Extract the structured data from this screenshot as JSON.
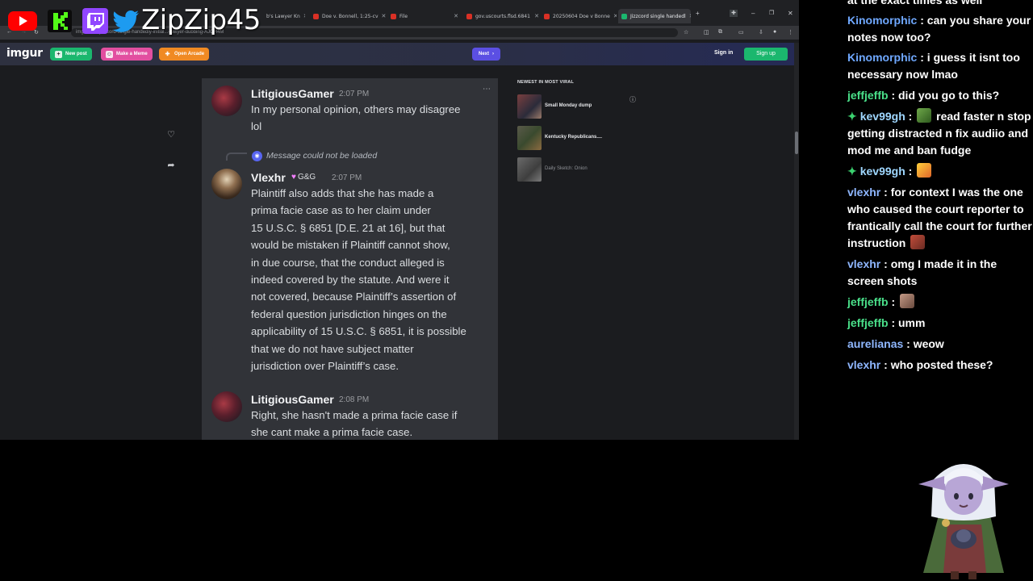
{
  "browser": {
    "tabs": [
      {
        "label": "b's Lawyer Kn",
        "color": "#8ab4f8"
      },
      {
        "label": "Doe v. Bonnell, 1:25-cv",
        "color": "#d93025"
      },
      {
        "label": "File",
        "color": "#d93025"
      },
      {
        "label": "gov.uscourts.flsd.6841",
        "color": "#d93025"
      },
      {
        "label": "20250604 Doe v Bonne",
        "color": "#d93025"
      },
      {
        "label": "Jizzcord single handedl",
        "color": "#1bb76e"
      }
    ],
    "url": "imgur.com/jizzcord-single-handedly-initial...-lawyer-dubbing-AJOH4M"
  },
  "imgur": {
    "logo": "imgur",
    "new_post": "New post",
    "make_meme": "Make a Meme",
    "open_arcade": "Open Arcade",
    "next": "Next",
    "sign_in": "Sign in",
    "sign_up": "Sign up"
  },
  "discord": {
    "messages": [
      {
        "user": "LitigiousGamer",
        "time": "2:07 PM",
        "lines": [
          "In my personal opinion, others may disagree",
          "lol"
        ]
      },
      {
        "reply_text": "Message could not be loaded",
        "user": "Vlexhr",
        "role": "G&G",
        "time": "2:07 PM",
        "lines": [
          "Plaintiff also adds that she has made a",
          "prima facie case as to her claim under",
          "15 U.S.C. § 6851 [D.E. 21 at 16], but that",
          "would be mistaken if Plaintiff cannot show,",
          "in due course, that the conduct alleged is",
          "indeed covered by the statute. And were it",
          "not covered, because Plaintiff’s assertion of",
          "federal question jurisdiction hinges on the",
          "applicability of 15 U.S.C. § 6851, it is possible",
          "that we do not have subject matter",
          "jurisdiction over Plaintiff’s case."
        ]
      },
      {
        "user": "LitigiousGamer",
        "time": "2:08 PM",
        "lines": [
          "Right, she hasn't made a prima facie case if",
          "she cant make a prima facie case."
        ]
      }
    ]
  },
  "viral": {
    "heading": "NEWEST IN MOST VIRAL",
    "items": [
      {
        "title": "Small Monday dump"
      },
      {
        "title": "Kentucky Republicans...."
      },
      {
        "title": "Daily Sketch: Onion"
      }
    ]
  },
  "overlay": {
    "channel": "ZipZip45"
  },
  "chat": {
    "lines": [
      {
        "user": "",
        "text": "at the exact times as well",
        "color": "#ffffff"
      },
      {
        "user": "Kinomorphic",
        "text": ": can you share your notes now too?",
        "color": "#6fa8ff"
      },
      {
        "user": "Kinomorphic",
        "text": ": i guess it isnt too necessary now lmao",
        "color": "#6fa8ff"
      },
      {
        "user": "jeffjeffb",
        "text": ": did you go to this?",
        "color": "#4ae08a"
      },
      {
        "user": "kev99gh",
        "text": ":",
        "text2": "read faster n stop getting distracted n fix audiio and mod me and ban fudge",
        "color": "#9fd7ff"
      },
      {
        "user": "kev99gh",
        "text": ":",
        "color": "#9fd7ff"
      },
      {
        "user": "vlexhr",
        "text": ": for context I was the one who caused the court reporter to frantically call the court for further instruction",
        "color": "#8fb7ff"
      },
      {
        "user": "vlexhr",
        "text": ": omg I made it in the screen shots",
        "color": "#8fb7ff"
      },
      {
        "user": "jeffjeffb",
        "text": ":",
        "color": "#4ae08a"
      },
      {
        "user": "jeffjeffb",
        "text": ": umm",
        "color": "#4ae08a"
      },
      {
        "user": "aurelianas",
        "text": ": weow",
        "color": "#8fb7ff"
      },
      {
        "user": "vlexhr",
        "text": ": who posted these?",
        "color": "#8fb7ff"
      }
    ]
  }
}
